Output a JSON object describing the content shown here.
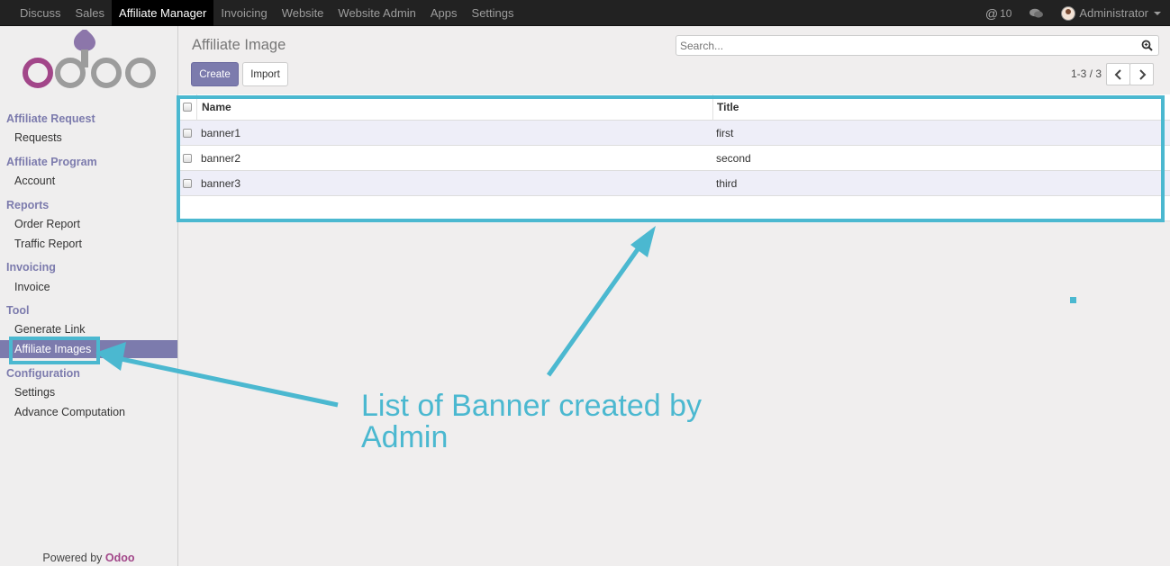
{
  "topbar": {
    "menu": [
      "Discuss",
      "Sales",
      "Affiliate Manager",
      "Invoicing",
      "Website",
      "Website Admin",
      "Apps",
      "Settings"
    ],
    "active_index": 2,
    "notifications_count": "10",
    "user_name": "Administrator"
  },
  "sidebar": {
    "sections": [
      {
        "title": "Affiliate Request",
        "items": [
          "Requests"
        ]
      },
      {
        "title": "Affiliate Program",
        "items": [
          "Account"
        ]
      },
      {
        "title": "Reports",
        "items": [
          "Order Report",
          "Traffic Report"
        ]
      },
      {
        "title": "Invoicing",
        "items": [
          "Invoice"
        ]
      },
      {
        "title": "Tool",
        "items": [
          "Generate Link",
          "Affiliate Images"
        ]
      },
      {
        "title": "Configuration",
        "items": [
          "Settings",
          "Advance Computation"
        ]
      }
    ],
    "active_item": "Affiliate Images",
    "powered_by": "Powered by",
    "powered_brand": "Odoo"
  },
  "main": {
    "title": "Affiliate Image",
    "search_placeholder": "Search...",
    "create_label": "Create",
    "import_label": "Import",
    "pager": "1-3 / 3"
  },
  "table": {
    "columns": [
      "Name",
      "Title"
    ],
    "rows": [
      {
        "name": "banner1",
        "title": "first"
      },
      {
        "name": "banner2",
        "title": "second"
      },
      {
        "name": "banner3",
        "title": "third"
      }
    ]
  },
  "annotation": {
    "text": "List of Banner created by Admin",
    "color": "#4bb8d0"
  },
  "colors": {
    "accent": "#7c7bad",
    "topbar": "#222222",
    "brand": "#a24689"
  }
}
